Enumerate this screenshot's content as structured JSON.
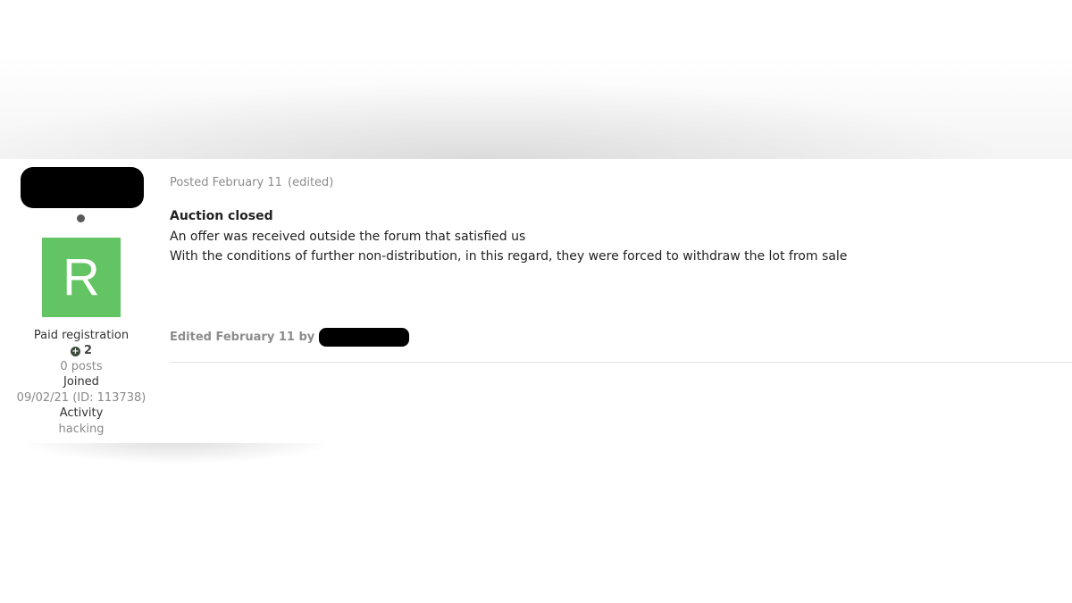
{
  "post": {
    "posted_label": "Posted",
    "posted_date": "February 11",
    "edited_flag": "(edited)",
    "title": "Auction closed",
    "lines": [
      "An offer was received outside the forum that satisfied us",
      "With the conditions of further non-distribution, in this regard, they were forced to withdraw the lot from sale"
    ],
    "edit_note": "Edited February 11 by"
  },
  "author": {
    "avatar_letter": "R",
    "avatar_color": "#62c462",
    "group": "Paid registration",
    "reputation": "2",
    "posts": "0 posts",
    "joined_label": "Joined",
    "joined_value": "09/02/21 (ID: 113738)",
    "activity_label": "Activity",
    "activity_value": "hacking"
  }
}
